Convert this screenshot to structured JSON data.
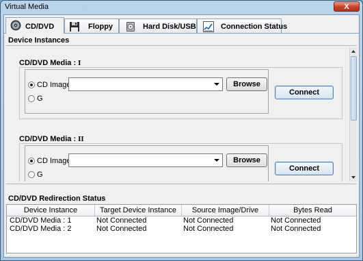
{
  "window": {
    "title": "Virtual Media",
    "close_label": "X"
  },
  "tabs": [
    {
      "label": "CD/DVD",
      "icon": "cd-icon"
    },
    {
      "label": "Floppy",
      "icon": "floppy-icon"
    },
    {
      "label": "Hard Disk/USB",
      "icon": "hard-disk-icon"
    },
    {
      "label": "Connection Status",
      "icon": "chart-icon"
    }
  ],
  "device_instances": {
    "title": "Device Instances",
    "groups": [
      {
        "label": "CD/DVD Media :",
        "roman": "I",
        "cd_image_label": "CD Image",
        "drive_label": "G",
        "combo_value": "",
        "browse_label": "Browse",
        "connect_label": "Connect",
        "cd_image_selected": true
      },
      {
        "label": "CD/DVD Media :",
        "roman": "II",
        "cd_image_label": "CD Image",
        "drive_label": "G",
        "combo_value": "",
        "browse_label": "Browse",
        "connect_label": "Connect",
        "cd_image_selected": true
      }
    ]
  },
  "redirection": {
    "title": "CD/DVD Redirection Status",
    "columns": [
      "Device Instance",
      "Target Device Instance",
      "Source Image/Drive",
      "Bytes Read"
    ],
    "rows": [
      [
        "CD/DVD Media :  1",
        "Not Connected",
        "Not Connected",
        "Not Connected"
      ],
      [
        "CD/DVD Media :  2",
        "Not Connected",
        "Not Connected",
        "Not Connected"
      ]
    ]
  }
}
